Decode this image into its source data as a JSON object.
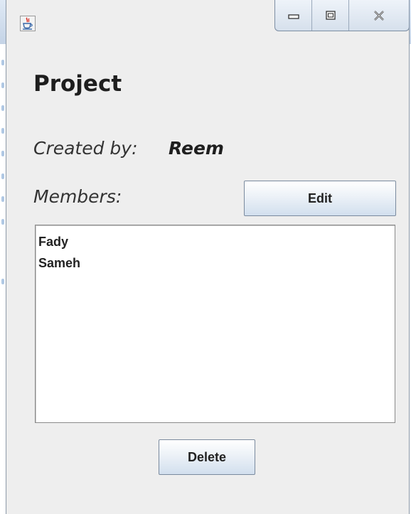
{
  "window": {
    "title": "",
    "controls": [
      "minimize",
      "maximize",
      "close"
    ]
  },
  "project": {
    "title": "Project",
    "created_by_label": "Created by:",
    "created_by_value": "Reem",
    "members_label": "Members:",
    "edit_label": "Edit",
    "delete_label": "Delete",
    "members": [
      "Fady",
      "Sameh"
    ]
  },
  "icons": {
    "app": "java-cup-icon",
    "minimize": "minimize-icon",
    "maximize": "maximize-icon",
    "close": "close-icon"
  },
  "colors": {
    "window_bg": "#eeeeee",
    "list_bg": "#ffffff",
    "text": "#222222",
    "button_gradient_bottom": "#d2dfee",
    "button_border": "#7a8a9e"
  }
}
